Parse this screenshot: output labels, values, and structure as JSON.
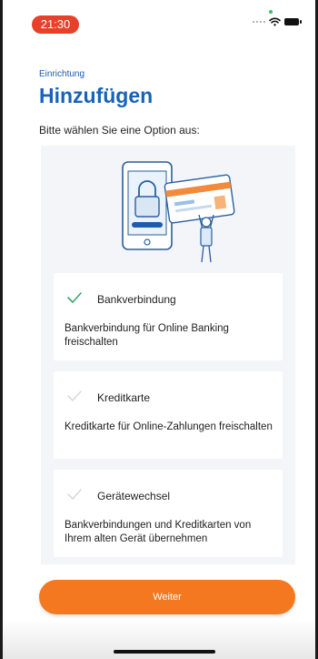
{
  "status_bar": {
    "time": "21:30"
  },
  "header": {
    "eyebrow": "Einrichtung",
    "title": "Hinzufügen",
    "subtitle": "Bitte wählen Sie eine Option aus:"
  },
  "options": [
    {
      "title": "Bankverbindung",
      "description": "Bankverbindung für Online Banking freischalten",
      "selected": true
    },
    {
      "title": "Kreditkarte",
      "description": "Kreditkarte für Online-Zahlungen freischalten",
      "selected": false
    },
    {
      "title": "Gerätewechsel",
      "description": "Bankverbindungen und Kreditkarten von Ihrem alten Gerät übernehmen",
      "selected": false
    }
  ],
  "primary_button": {
    "label": "Weiter"
  },
  "colors": {
    "accent_blue": "#1663b8",
    "button_orange": "#f3781f",
    "check_green": "#3aa86a",
    "check_muted": "#d6d6d6",
    "time_pill": "#e8412b"
  },
  "icons": [
    "wifi-icon",
    "battery-icon",
    "signal-dots-icon",
    "checkmark-icon",
    "phone-lock-card-illustration"
  ]
}
